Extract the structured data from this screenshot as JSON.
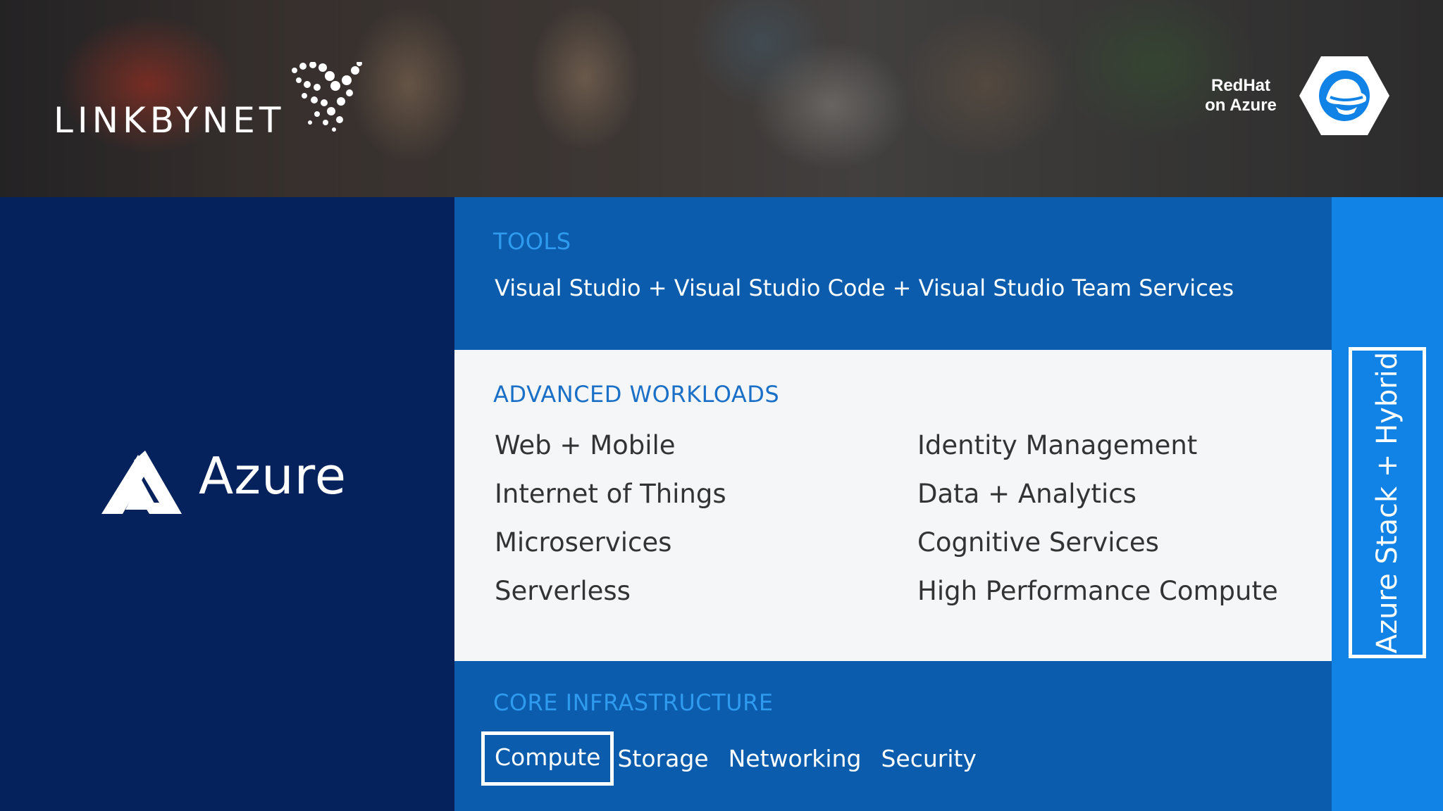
{
  "header": {
    "brand_logo_text": "LINKBYNET",
    "badge_label_line1": "RedHat",
    "badge_label_line2": "on Azure",
    "badge_icon": "redhat-logo-icon"
  },
  "left_panel": {
    "product_name": "Azure",
    "product_icon": "azure-logo-icon"
  },
  "tools": {
    "title": "TOOLS",
    "line": "Visual Studio + Visual Studio Code + Visual Studio Team Services"
  },
  "workloads": {
    "title": "ADVANCED WORKLOADS",
    "left_items": [
      "Web + Mobile",
      "Internet of Things",
      "Microservices",
      "Serverless"
    ],
    "right_items": [
      "Identity Management",
      "Data + Analytics",
      "Cognitive Services",
      "High Performance Compute"
    ]
  },
  "core": {
    "title": "CORE INFRASTRUCTURE",
    "items": [
      "Compute",
      "Storage",
      "Networking",
      "Security"
    ],
    "selected": "Compute"
  },
  "hybrid": {
    "label": "Azure Stack + Hybrid"
  },
  "colors": {
    "left_panel": "#05225c",
    "section_blue": "#0b5cad",
    "accent_blue": "#2f9bef",
    "right_column": "#1283e6",
    "workloads_bg": "#f5f6f8"
  }
}
